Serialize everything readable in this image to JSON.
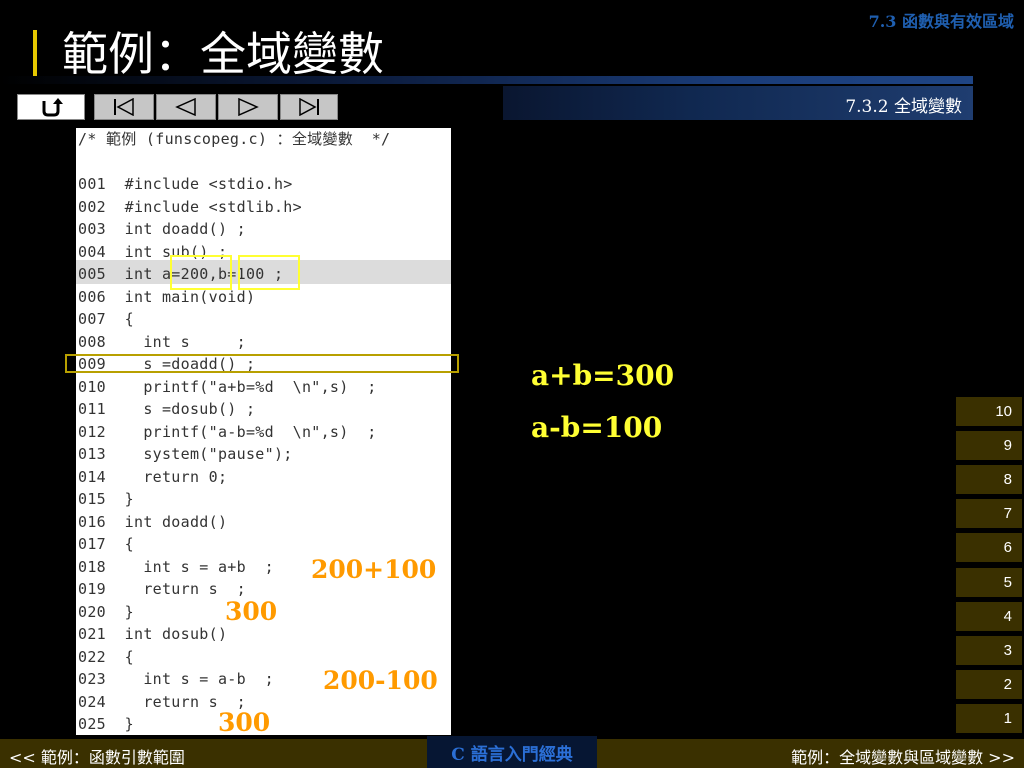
{
  "header": {
    "section_tag": "7.3 函數與有效區域",
    "title": "範例：全域變數",
    "subsection": "7.3.2 全域變數"
  },
  "nav": {
    "buttons": [
      {
        "name": "return",
        "icon": "return-arrow-icon"
      },
      {
        "name": "first",
        "icon": "skip-to-first-icon"
      },
      {
        "name": "prev",
        "icon": "previous-triangle-icon"
      },
      {
        "name": "next",
        "icon": "next-triangle-icon"
      },
      {
        "name": "last",
        "icon": "skip-to-last-icon"
      }
    ]
  },
  "code": {
    "lines": [
      "/* 範例 (funscopeg.c) ：全域變數  */",
      "",
      "001  #include <stdio.h>",
      "002  #include <stdlib.h>",
      "003  int doadd() ;",
      "004  int sub() ;",
      "005  int a=200,b=100 ;",
      "006  int main(void)",
      "007  {",
      "008    int s     ;",
      "009    s =doadd() ;",
      "010    printf(\"a+b=%d  \\n\",s)  ;",
      "011    s =dosub() ;",
      "012    printf(\"a-b=%d  \\n\",s)  ;",
      "013    system(\"pause\");",
      "014    return 0;",
      "015  }",
      "016  int doadd()",
      "017  {",
      "018    int s = a+b  ;",
      "019    return s  ;",
      "020  }",
      "021  int dosub()",
      "022  {",
      "023    int s = a-b  ;",
      "024    return s  ;",
      "025  }"
    ]
  },
  "annotations": {
    "add_expr": "200+100",
    "add_result": "300",
    "sub_expr": "200-100",
    "sub_result": "300"
  },
  "output": {
    "sum_line": "a+b=300",
    "diff_line": "a-b=100"
  },
  "pages": [
    "10",
    "9",
    "8",
    "7",
    "6",
    "5",
    "4",
    "3",
    "2",
    "1"
  ],
  "footer": {
    "prev_link": "<< 範例：函數引數範圍",
    "book_title": "C 語言入門經典",
    "next_link": "範例：全域變數與區域變數 >>"
  },
  "colors": {
    "background": "#000000",
    "accent_yellow": "#ffff33",
    "annotation_orange": "#ff9a00",
    "footer_olive": "#3a3000",
    "book_blue": "#2b6fd6"
  }
}
